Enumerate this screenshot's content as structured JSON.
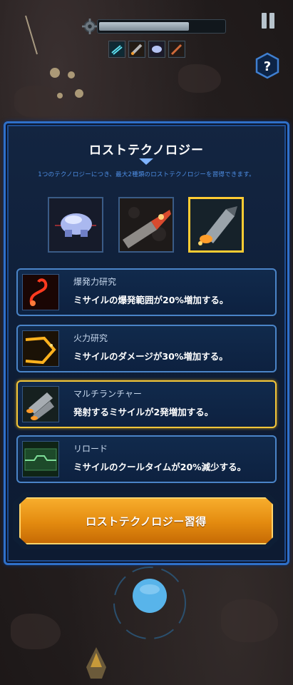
{
  "hud": {
    "progress_fraction": 0.72,
    "skill_slots": [
      "ice-skill",
      "missile-skill",
      "drone-skill",
      "laser-skill"
    ]
  },
  "panel": {
    "title": "ロストテクノロジー",
    "description": "1つのテクノロジーにつき、最大2種類のロストテクノロジーを習得できます。",
    "tech_icons": [
      "drone-icon",
      "gatling-icon",
      "missile-icon"
    ],
    "selected_tech_index": 2,
    "options": [
      {
        "name": "爆発力研究",
        "desc": "ミサイルの爆発範囲が20%増加する。",
        "icon": "explosion-icon",
        "selected": false
      },
      {
        "name": "火力研究",
        "desc": "ミサイルのダメージが30%増加する。",
        "icon": "firepower-icon",
        "selected": false
      },
      {
        "name": "マルチランチャー",
        "desc": "発射するミサイルが2発増加する。",
        "icon": "multi-launcher-icon",
        "selected": true
      },
      {
        "name": "リロード",
        "desc": "ミサイルのクールタイムが20%減少する。",
        "icon": "reload-icon",
        "selected": false
      }
    ],
    "acquire_label": "ロストテクノロジー習得"
  },
  "colors": {
    "panel_border": "#2f70c9",
    "selected_border": "#f3c63a",
    "accent_text": "#4e8fe6",
    "button_orange": "#e38a0f"
  }
}
